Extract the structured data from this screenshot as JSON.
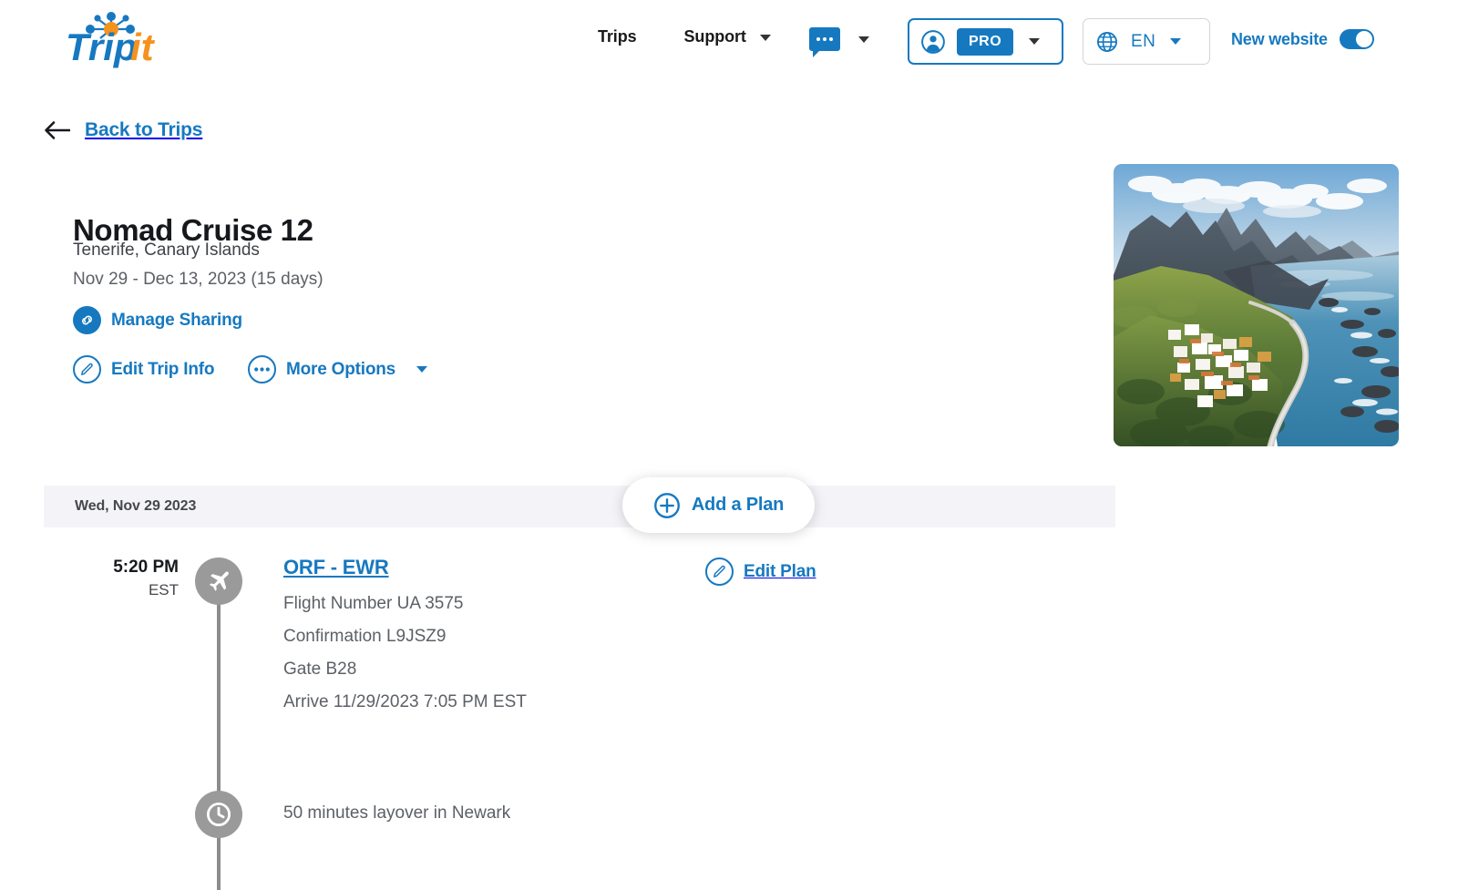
{
  "header": {
    "logo": {
      "name": "TripIt",
      "part_blue": "Trip",
      "part_orange": "it"
    },
    "nav": [
      {
        "id": "trips",
        "label": "Trips",
        "has_caret": false
      },
      {
        "id": "support",
        "label": "Support",
        "has_caret": true
      }
    ],
    "chat": {
      "icon": "chat-bubble-icon",
      "has_caret": true
    },
    "account": {
      "icon": "avatar-icon",
      "badge": "PRO",
      "has_caret": true
    },
    "language": {
      "icon": "globe-icon",
      "value": "EN",
      "has_caret": true
    },
    "new_website": {
      "label": "New website",
      "toggle_on": true
    }
  },
  "back": {
    "label": "Back to Trips",
    "icon": "arrow-left-icon"
  },
  "trip": {
    "title": "Nomad Cruise 12",
    "location": "Tenerife, Canary Islands",
    "dates": "Nov 29 - Dec 13, 2023 (15 days)",
    "actions": {
      "manage_sharing": "Manage Sharing",
      "edit_trip_info": "Edit Trip Info",
      "more_options": "More Options"
    },
    "photo_alt": "Tenerife coastline with village, mountains and ocean"
  },
  "itinerary": {
    "day_label": "Wed, Nov 29 2023",
    "add_plan_label": "Add a Plan",
    "plans": [
      {
        "type": "flight",
        "time": "5:20 PM",
        "timezone": "EST",
        "title": "ORF - EWR",
        "details": [
          "Flight Number UA 3575",
          "Confirmation L9JSZ9",
          "Gate B28",
          "Arrive 11/29/2023 7:05 PM EST"
        ],
        "edit_label": "Edit Plan"
      },
      {
        "type": "layover",
        "text": "50 minutes layover in Newark"
      }
    ]
  },
  "colors": {
    "brand_blue": "#1679c0",
    "brand_orange": "#f5921e",
    "text_dark": "#16181c",
    "text_muted": "#5c6066",
    "day_bar_bg": "#f4f4f8",
    "timeline_gray": "#9a9a9a"
  }
}
